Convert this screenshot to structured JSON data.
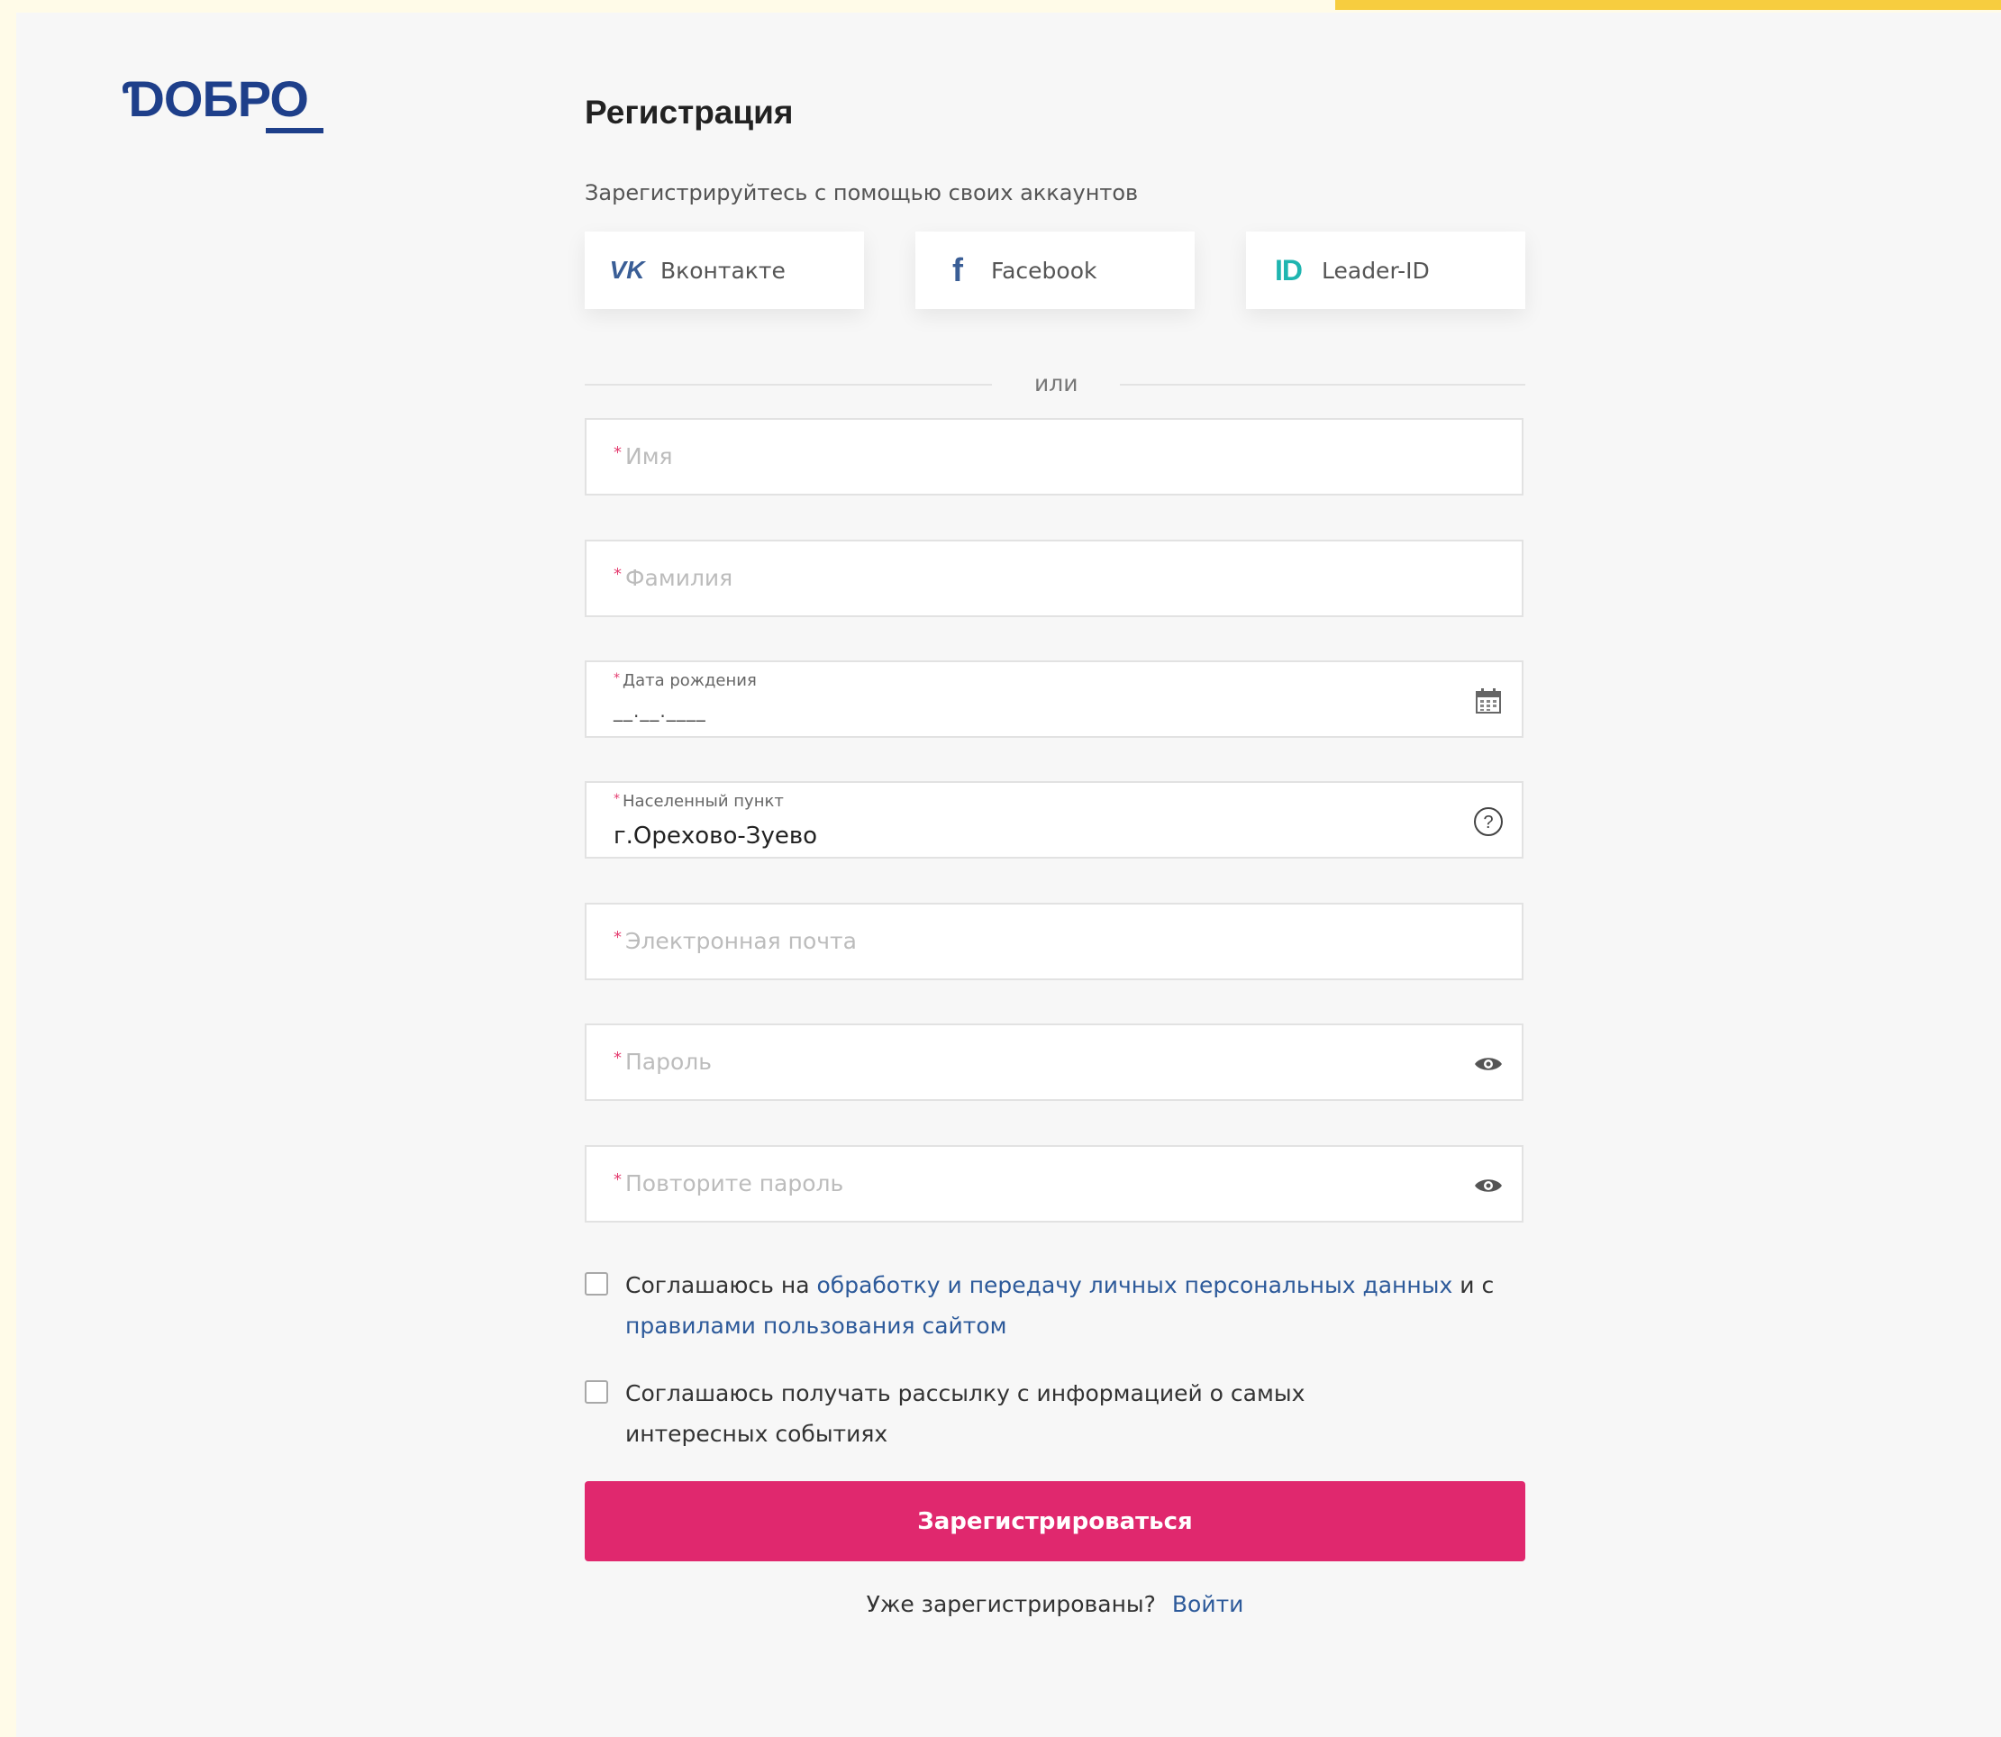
{
  "brand": {
    "logo_text": "ƊОБРО",
    "accent_color": "#e0286e",
    "brand_color": "#1e3f8a",
    "link_color": "#2d5a9a"
  },
  "page": {
    "title": "Регистрация",
    "subtitle": "Зарегистрируйтесь с помощью своих аккаунтов"
  },
  "social": [
    {
      "label": "Вконтакте",
      "icon": "vk-icon"
    },
    {
      "label": "Facebook",
      "icon": "facebook-icon"
    },
    {
      "label": "Leader-ID",
      "icon": "leader-id-icon"
    }
  ],
  "divider": "или",
  "form": {
    "required_mark": "*",
    "first_name": {
      "placeholder": "Имя"
    },
    "last_name": {
      "placeholder": "Фамилия"
    },
    "birth_date": {
      "label": "Дата рождения",
      "mask": "__.__.____",
      "icon": "calendar-icon"
    },
    "locality": {
      "label": "Населенный пункт",
      "value": "г.Орехово-Зуево",
      "icon": "help-icon"
    },
    "email": {
      "placeholder": "Электронная почта"
    },
    "password": {
      "placeholder": "Пароль",
      "icon": "eye-icon"
    },
    "password_repeat": {
      "placeholder": "Повторите пароль",
      "icon": "eye-icon"
    }
  },
  "consent": {
    "pd_prefix": "Соглашаюсь на",
    "pd_link": "обработку и передачу личных персональных данных",
    "pd_middle": "и с",
    "rules_link": "правилами пользования сайтом",
    "newsletter": "Соглашаюсь получать рассылку с информацией о самых интересных событиях"
  },
  "submit_label": "Зарегистрироваться",
  "footer": {
    "already": "Уже зарегистрированы?",
    "login": "Войти"
  }
}
